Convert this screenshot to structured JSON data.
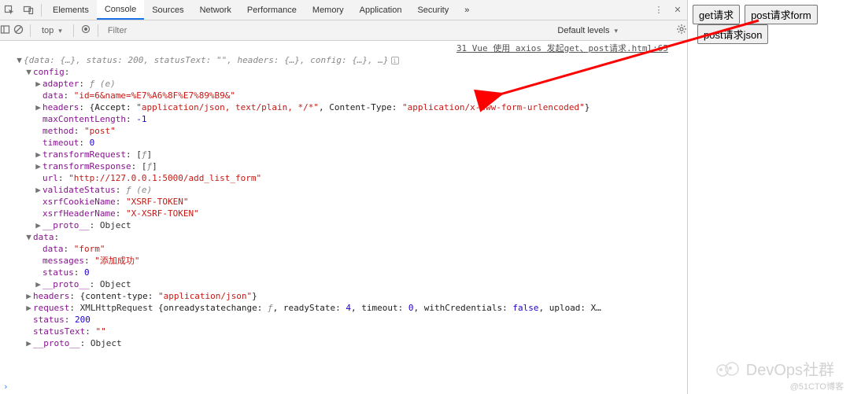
{
  "topbar": {
    "tabs": [
      "Elements",
      "Console",
      "Sources",
      "Network",
      "Performance",
      "Memory",
      "Application",
      "Security"
    ],
    "active_index": 1,
    "more_glyph": "»",
    "menu_glyph": "⋮",
    "close_glyph": "✕"
  },
  "consolebar": {
    "context": "top",
    "filter_placeholder": "Filter",
    "levels_label": "Default levels"
  },
  "source_link": "31 Vue 使用 axios 发起get、post请求.html:65",
  "lines": [
    {
      "ind": 0,
      "tw": "▼",
      "raw": true,
      "html": "<span class='ital'>{data: {…}, status: 200, statusText: \"\", headers: {…}, config: {…}, …}</span><span class='infoicon'>i</span>"
    },
    {
      "ind": 1,
      "tw": "▼",
      "key": "config",
      "after": ":"
    },
    {
      "ind": 2,
      "tw": "▶",
      "key": "adapter",
      "after": ": <span class='ital'>ƒ (e)</span>"
    },
    {
      "ind": 2,
      "tw": "",
      "key": "data",
      "after": ": <span class='str'>\"id=6&name=%E7%A6%8F%E7%89%B9&\"</span>"
    },
    {
      "ind": 2,
      "tw": "▶",
      "key": "headers",
      "after": ": <span class='obj'>{Accept: </span><span class='str'>\"application/json, text/plain, */*\"</span><span class='obj'>, Content-Type: </span><span class='str'>\"application/x-www-form-urlencoded\"</span><span class='obj'>}</span>"
    },
    {
      "ind": 2,
      "tw": "",
      "key": "maxContentLength",
      "after": ": <span class='num'>-1</span>"
    },
    {
      "ind": 2,
      "tw": "",
      "key": "method",
      "after": ": <span class='str'>\"post\"</span>"
    },
    {
      "ind": 2,
      "tw": "",
      "key": "timeout",
      "after": ": <span class='num'>0</span>"
    },
    {
      "ind": 2,
      "tw": "▶",
      "key": "transformRequest",
      "after": ": [<span class='ital'>ƒ</span>]"
    },
    {
      "ind": 2,
      "tw": "▶",
      "key": "transformResponse",
      "after": ": [<span class='ital'>ƒ</span>]"
    },
    {
      "ind": 2,
      "tw": "",
      "key": "url",
      "after": ": <span class='str'>\"http://127.0.0.1:5000/add_list_form\"</span>"
    },
    {
      "ind": 2,
      "tw": "▶",
      "key": "validateStatus",
      "after": ": <span class='ital'>ƒ (e)</span>"
    },
    {
      "ind": 2,
      "tw": "",
      "key": "xsrfCookieName",
      "after": ": <span class='str'>\"XSRF-TOKEN\"</span>"
    },
    {
      "ind": 2,
      "tw": "",
      "key": "xsrfHeaderName",
      "after": ": <span class='str'>\"X-XSRF-TOKEN\"</span>"
    },
    {
      "ind": 2,
      "tw": "▶",
      "key": "__proto__",
      "after": ": Object"
    },
    {
      "ind": 1,
      "tw": "▼",
      "key": "data",
      "after": ":"
    },
    {
      "ind": 2,
      "tw": "",
      "key": "data",
      "after": ": <span class='str'>\"form\"</span>"
    },
    {
      "ind": 2,
      "tw": "",
      "key": "messages",
      "after": ": <span class='str'>\"添加成功\"</span>"
    },
    {
      "ind": 2,
      "tw": "",
      "key": "status",
      "after": ": <span class='num'>0</span>"
    },
    {
      "ind": 2,
      "tw": "▶",
      "key": "__proto__",
      "after": ": Object"
    },
    {
      "ind": 1,
      "tw": "▶",
      "key": "headers",
      "after": ": <span class='obj'>{content-type: </span><span class='str'>\"application/json\"</span><span class='obj'>}</span>"
    },
    {
      "ind": 1,
      "tw": "▶",
      "key": "request",
      "after": ": XMLHttpRequest <span class='obj'>{onreadystatechange: <span class='ital'>ƒ</span>, readyState: <span class='num'>4</span>, timeout: <span class='num'>0</span>, withCredentials: <span class='num'>false</span>, upload: X…</span>"
    },
    {
      "ind": 1,
      "tw": "",
      "key": "status",
      "after": ": <span class='num'>200</span>"
    },
    {
      "ind": 1,
      "tw": "",
      "key": "statusText",
      "after": ": <span class='str'>\"\"</span>"
    },
    {
      "ind": 1,
      "tw": "▶",
      "key": "__proto__",
      "after": ": Object"
    }
  ],
  "page_buttons": [
    "get请求",
    "post请求form",
    "post请求json"
  ],
  "watermark": "DevOps社群",
  "credit": "@51CTO博客"
}
